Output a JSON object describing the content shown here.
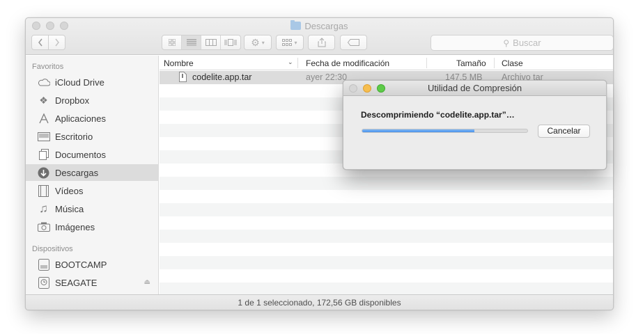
{
  "window": {
    "title": "Descargas"
  },
  "toolbar": {
    "back_icon": "chevron-left-icon",
    "forward_icon": "chevron-right-icon",
    "view_icons": [
      "icon-view-icon",
      "list-view-icon",
      "column-view-icon",
      "coverflow-view-icon"
    ],
    "active_view": "list",
    "action_icon": "gear-icon",
    "arrange_icon": "arrange-grid-icon",
    "share_icon": "share-icon",
    "tag_icon": "tag-icon",
    "search_placeholder": "Buscar"
  },
  "sidebar": {
    "sections": [
      {
        "heading": "Favoritos",
        "items": [
          {
            "label": "iCloud Drive",
            "icon": "cloud-icon"
          },
          {
            "label": "Dropbox",
            "icon": "dropbox-icon"
          },
          {
            "label": "Aplicaciones",
            "icon": "applications-icon"
          },
          {
            "label": "Escritorio",
            "icon": "desktop-icon"
          },
          {
            "label": "Documentos",
            "icon": "documents-icon"
          },
          {
            "label": "Descargas",
            "icon": "downloads-icon",
            "selected": true
          },
          {
            "label": "Vídeos",
            "icon": "film-icon"
          },
          {
            "label": "Música",
            "icon": "music-icon"
          },
          {
            "label": "Imágenes",
            "icon": "camera-icon"
          }
        ]
      },
      {
        "heading": "Dispositivos",
        "items": [
          {
            "label": "BOOTCAMP",
            "icon": "disk-icon"
          },
          {
            "label": "SEAGATE",
            "icon": "time-machine-disk-icon",
            "eject": true
          }
        ]
      }
    ]
  },
  "table": {
    "columns": [
      "Nombre",
      "Fecha de modificación",
      "Tamaño",
      "Clase"
    ],
    "rows": [
      {
        "name": "codelite.app.tar",
        "date": "ayer 22:30",
        "size": "147,5 MB",
        "kind": "Archivo tar",
        "selected": true
      }
    ]
  },
  "status": {
    "text": "1 de 1 seleccionado, 172,56 GB disponibles"
  },
  "dialog": {
    "title": "Utilidad de Compresión",
    "message": "Descomprimiendo “codelite.app.tar”…",
    "progress": 0.68,
    "cancel_label": "Cancelar",
    "colors": {
      "close": "#d6d6d6",
      "minimize": "#f6be4f",
      "zoom": "#5ecb49",
      "progress": "#4c93ea"
    }
  }
}
